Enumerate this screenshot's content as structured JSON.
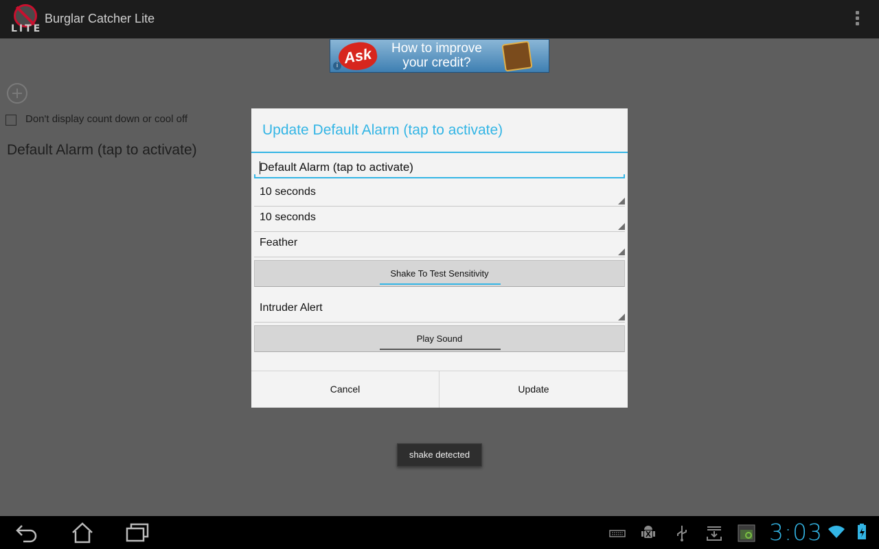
{
  "action_bar": {
    "app_title": "Burglar Catcher Lite",
    "app_icon_badge": "LITE",
    "overflow_icon": "overflow-menu-icon"
  },
  "ad": {
    "brand": "Ask",
    "text": "How to improve your credit?"
  },
  "background": {
    "add_icon": "add-circle-icon",
    "checkbox_label": "Don't display count down or cool off",
    "checkbox_checked": false,
    "alarm_item": "Default Alarm (tap to activate)"
  },
  "dialog": {
    "title": "Update Default Alarm (tap to activate)",
    "name_value": "Default Alarm (tap to activate)",
    "spinner_1": "10 seconds",
    "spinner_2": "10 seconds",
    "spinner_3": "Feather",
    "shake_button": "Shake To Test Sensitivity",
    "spinner_4": "Intruder Alert",
    "play_button": "Play Sound",
    "cancel": "Cancel",
    "update": "Update"
  },
  "toast": "shake detected",
  "nav_bar": {
    "back_icon": "back-icon",
    "home_icon": "home-icon",
    "recents_icon": "recent-apps-icon",
    "status_icons": [
      "keyboard-icon",
      "android-debug-icon",
      "usb-icon",
      "download-icon",
      "screenshot-icon"
    ],
    "clock": "3:03",
    "accent_color": "#33b5e5"
  }
}
